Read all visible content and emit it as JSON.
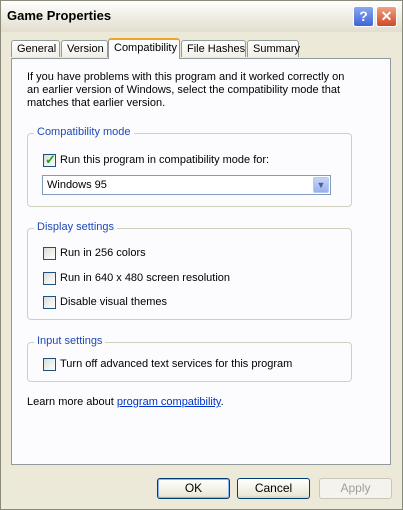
{
  "window": {
    "title": "Game Properties"
  },
  "tabs": [
    {
      "label": "General"
    },
    {
      "label": "Version"
    },
    {
      "label": "Compatibility",
      "active": true
    },
    {
      "label": "File Hashes"
    },
    {
      "label": "Summary"
    }
  ],
  "compat": {
    "intro": "If you have problems with this program and it worked correctly on an earlier version of Windows, select the compatibility mode that matches that earlier version.",
    "mode_group": {
      "legend": "Compatibility mode",
      "run_compat_label": "Run this program in compatibility mode for:",
      "run_compat_checked": true,
      "selected_os": "Windows 95"
    },
    "display_group": {
      "legend": "Display settings",
      "items": [
        {
          "label": "Run in 256 colors",
          "checked": false
        },
        {
          "label": "Run in 640 x 480 screen resolution",
          "checked": false
        },
        {
          "label": "Disable visual themes",
          "checked": false
        }
      ]
    },
    "input_group": {
      "legend": "Input settings",
      "items": [
        {
          "label": "Turn off advanced text services for this program",
          "checked": false
        }
      ]
    },
    "learn_more_prefix": "Learn more about ",
    "learn_more_link": "program compatibility",
    "learn_more_suffix": "."
  },
  "buttons": {
    "ok": "OK",
    "cancel": "Cancel",
    "apply": "Apply"
  },
  "icons": {
    "help": "?",
    "close": "✕",
    "dropdown": "▼",
    "check": "✓"
  }
}
